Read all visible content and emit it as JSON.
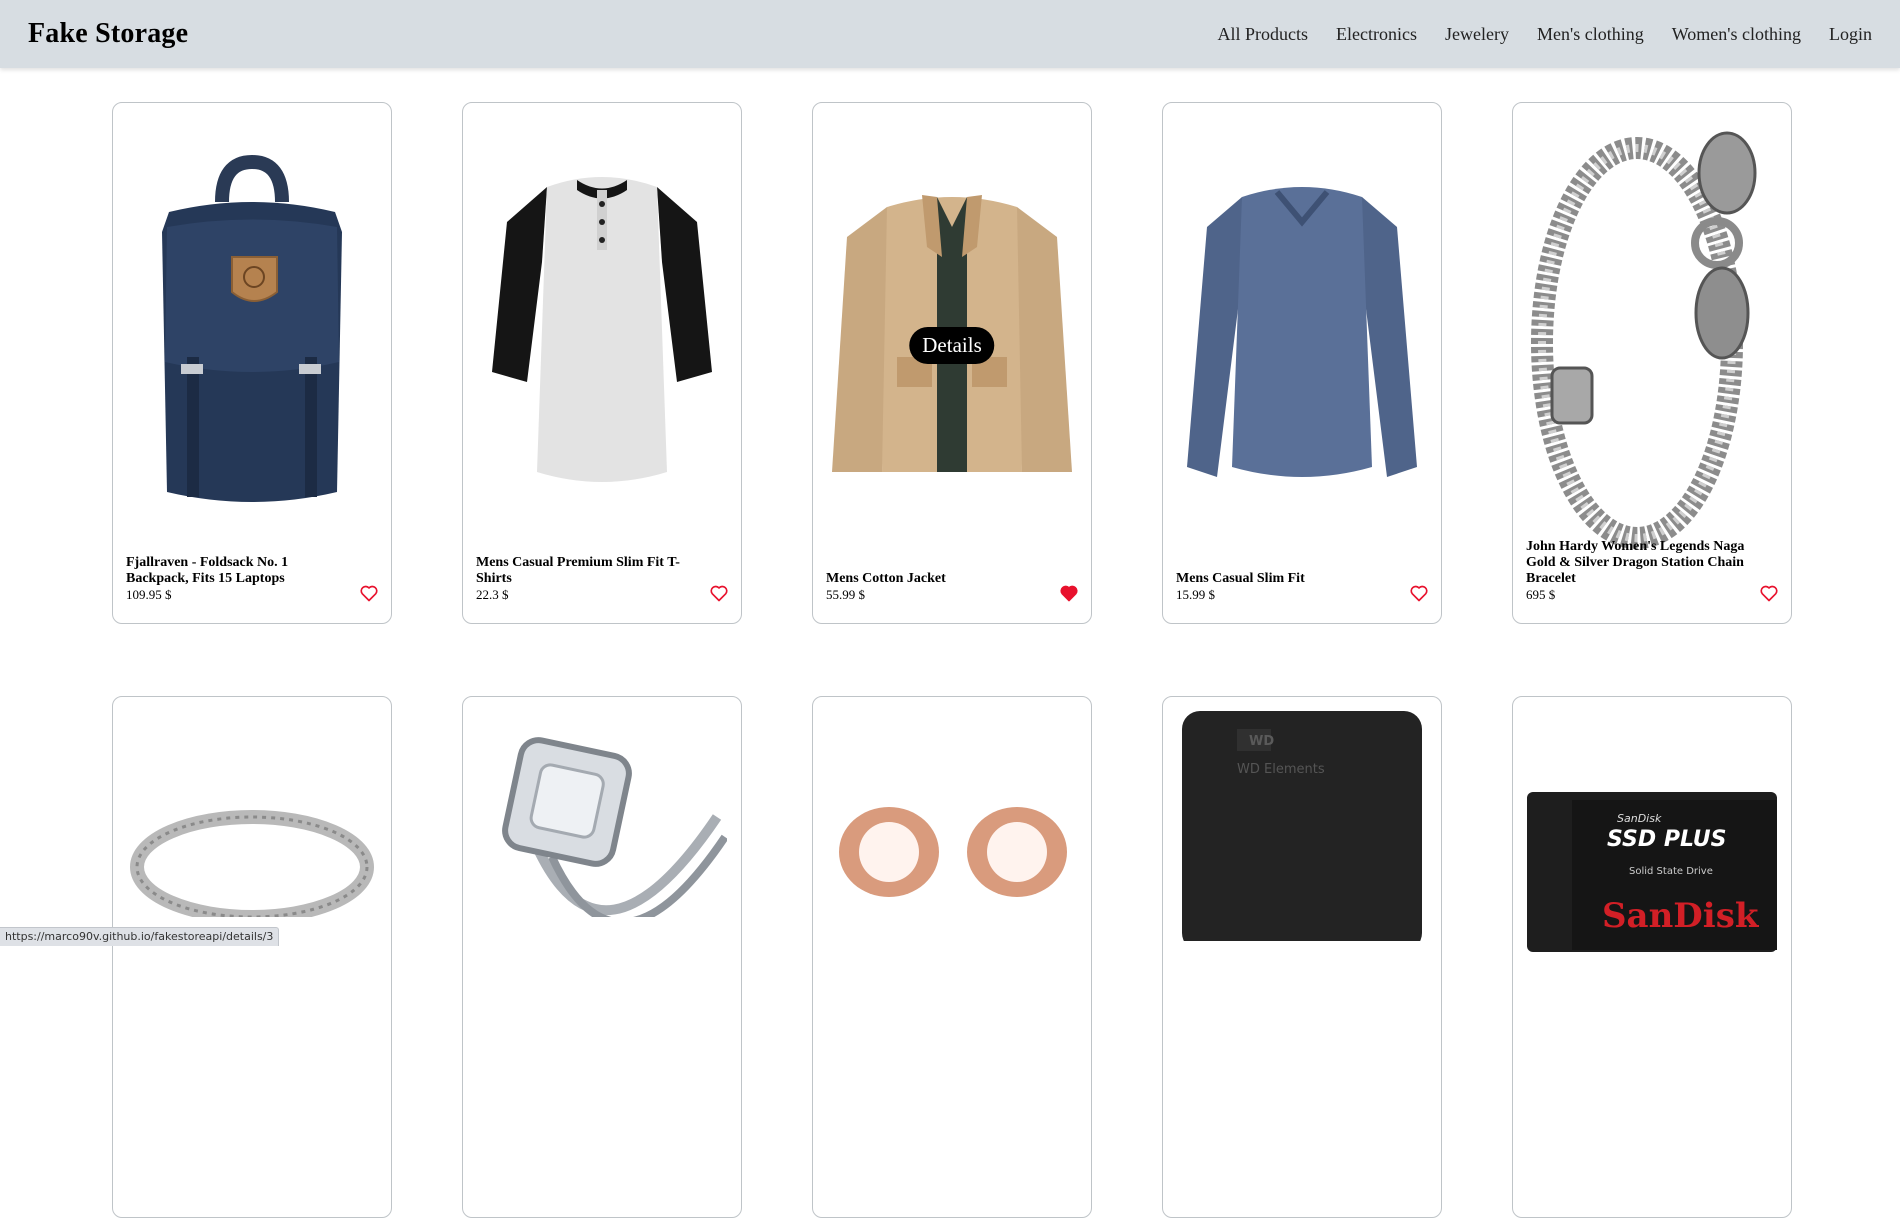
{
  "header": {
    "brand": "Fake Storage",
    "nav": [
      "All Products",
      "Electronics",
      "Jewelery",
      "Men's clothing",
      "Women's clothing",
      "Login"
    ]
  },
  "products": [
    {
      "title": "Fjallraven - Foldsack No. 1 Backpack, Fits 15 Laptops",
      "price": "109.95 $",
      "favorite": false,
      "icon": "backpack-image"
    },
    {
      "title": "Mens Casual Premium Slim Fit T-Shirts",
      "price": "22.3 $",
      "favorite": false,
      "icon": "tshirt-image"
    },
    {
      "title": "Mens Cotton Jacket",
      "price": "55.99 $",
      "favorite": true,
      "icon": "jacket-image",
      "hover_label": "Details"
    },
    {
      "title": "Mens Casual Slim Fit",
      "price": "15.99 $",
      "favorite": false,
      "icon": "longsleeve-image"
    },
    {
      "title": "John Hardy Women's Legends Naga Gold & Silver Dragon Station Chain Bracelet",
      "price": "695 $",
      "favorite": false,
      "icon": "bracelet-image"
    }
  ],
  "second_row": [
    {
      "icon": "ring-image"
    },
    {
      "icon": "engagement-ring-image"
    },
    {
      "icon": "rose-gold-earrings-image"
    },
    {
      "icon": "wd-hard-drive-image",
      "visible_text": "WD Elements"
    },
    {
      "icon": "sandisk-ssd-image",
      "visible_text": [
        "SanDisk",
        "SSD PLUS",
        "Solid State Drive",
        "SanDisk"
      ]
    }
  ],
  "status_bar": {
    "url": "https://marco90v.github.io/fakestoreapi/details/3"
  },
  "colors": {
    "header_bg": "#d7dde2",
    "favorite_red": "#e8112d",
    "heart_outline": "#e8112d"
  }
}
